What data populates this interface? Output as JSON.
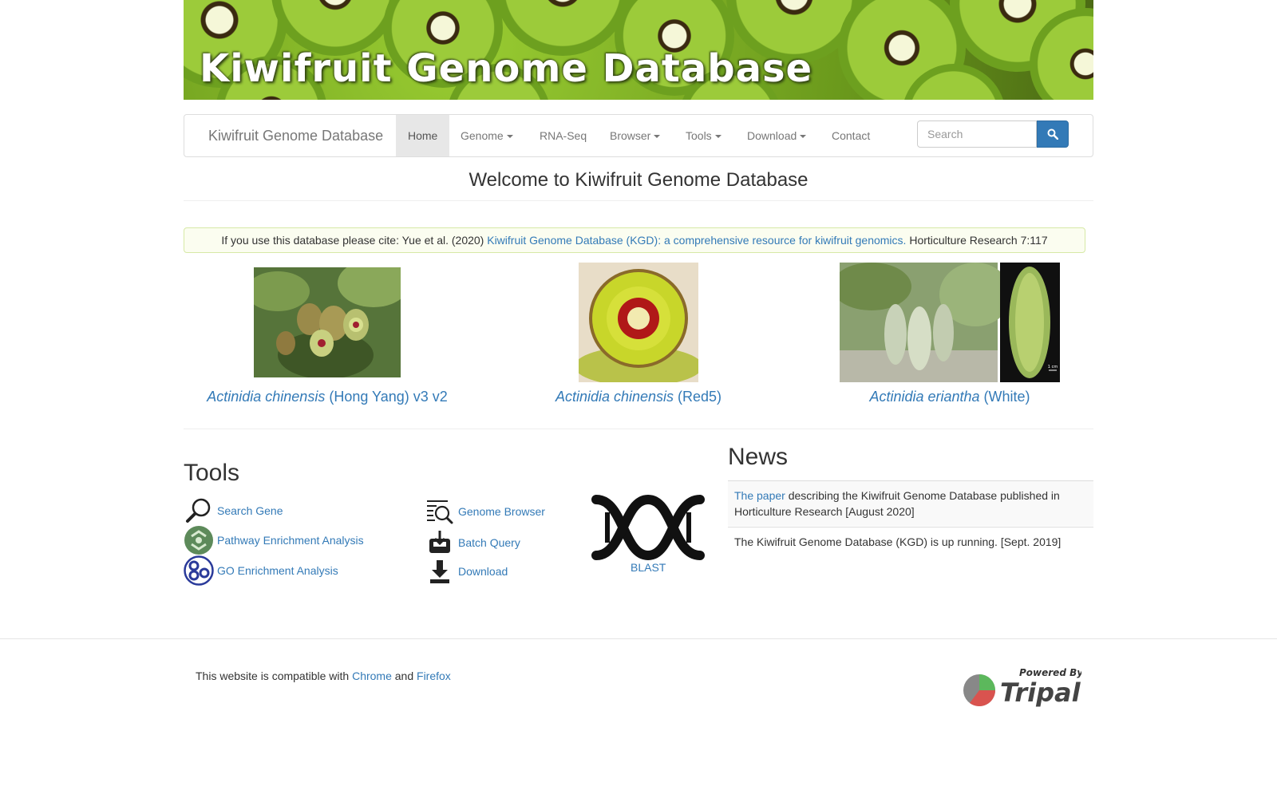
{
  "banner": {
    "title": "Kiwifruit Genome Database"
  },
  "navbar": {
    "brand": "Kiwifruit Genome Database",
    "items": [
      {
        "label": "Home",
        "active": true,
        "dropdown": false
      },
      {
        "label": "Genome",
        "dropdown": true
      },
      {
        "label": "RNA-Seq",
        "dropdown": false
      },
      {
        "label": "Browser",
        "dropdown": true
      },
      {
        "label": "Tools",
        "dropdown": true
      },
      {
        "label": "Download",
        "dropdown": true
      },
      {
        "label": "Contact",
        "dropdown": false
      }
    ],
    "search": {
      "placeholder": "Search",
      "value": ""
    }
  },
  "welcome": "Welcome to Kiwifruit Genome Database",
  "citation": {
    "prefix": "If you use this database please cite: Yue et al. (2020)",
    "link": "Kiwifruit Genome Database (KGD): a comprehensive resource for kiwifruit genomics.",
    "suffix": "Horticulture Research 7:117"
  },
  "species": [
    {
      "genus": "Actinidia chinensis",
      "label": "(Hong Yang) v3 v2"
    },
    {
      "genus": "Actinidia chinensis",
      "label": "(Red5)"
    },
    {
      "genus": "Actinidia eriantha",
      "label": "(White)"
    }
  ],
  "species_image_label": "1 cm",
  "tools": {
    "title": "Tools",
    "items": [
      {
        "label": "Search Gene",
        "icon": "magnifier-icon"
      },
      {
        "label": "Pathway Enrichment Analysis",
        "icon": "pathway-icon"
      },
      {
        "label": "GO Enrichment Analysis",
        "icon": "go-icon"
      },
      {
        "label": "Genome Browser",
        "icon": "genome-browser-icon"
      },
      {
        "label": "Batch Query",
        "icon": "batch-query-icon"
      },
      {
        "label": "Download",
        "icon": "download-icon"
      }
    ],
    "blast": "BLAST"
  },
  "news": {
    "title": "News",
    "items": [
      {
        "link": "The paper",
        "text": "describing the Kiwifruit Genome Database published in Horticulture Research [August 2020]"
      },
      {
        "link": "",
        "text": "The Kiwifruit Genome Database (KGD) is up running. [Sept. 2019]"
      }
    ]
  },
  "footer": {
    "compat_prefix": "This website is compatible with",
    "chrome": "Chrome",
    "and": "and",
    "firefox": "Firefox",
    "powered_by": "Powered By",
    "tripal": "Tripal"
  },
  "colors": {
    "link": "#337ab7",
    "search_button": "#337ab7",
    "citation_bg": "#fbfdf0"
  }
}
